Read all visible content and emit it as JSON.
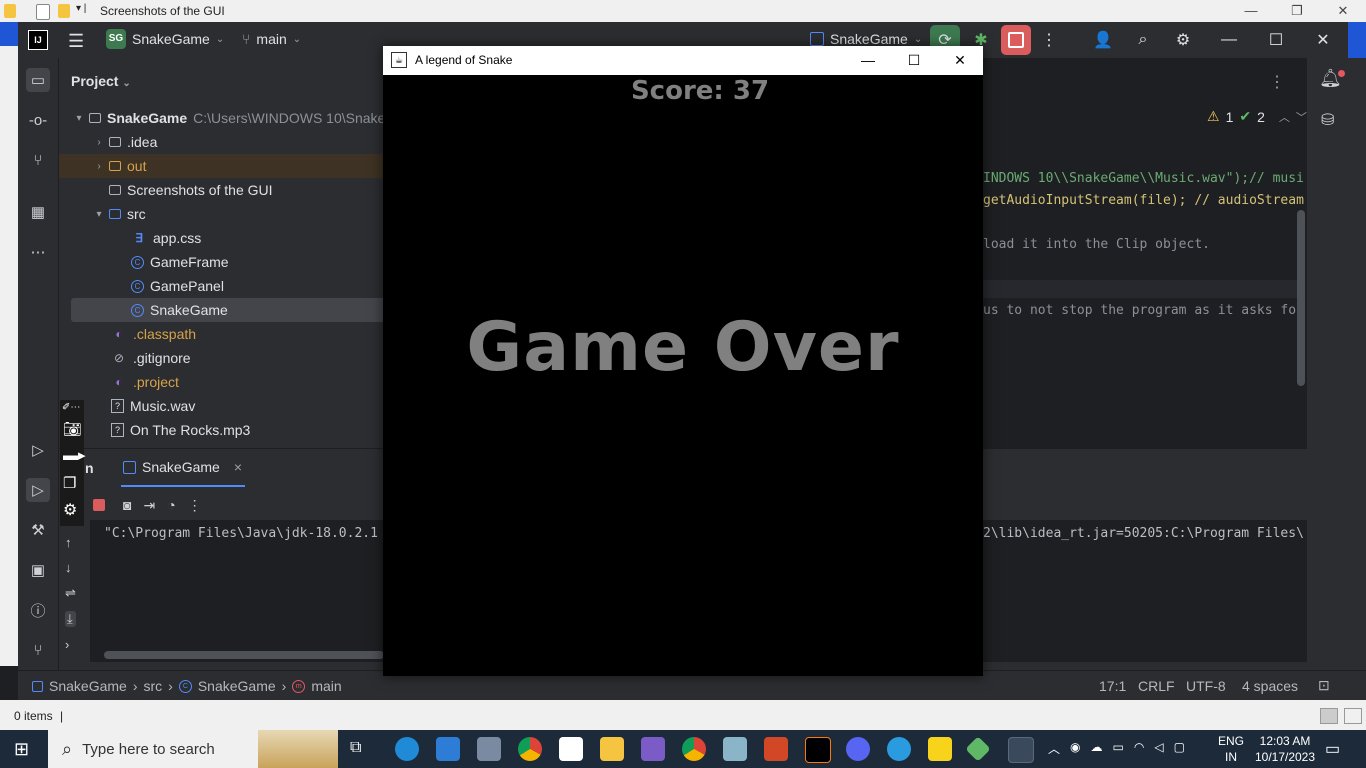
{
  "explorer": {
    "title": "Screenshots of the GUI",
    "status_items": "0 items"
  },
  "ide": {
    "project_badge": "SG",
    "project_name": "SnakeGame",
    "branch": "main",
    "run_config": "SnakeGame"
  },
  "project_panel": {
    "header": "Project",
    "root_name": "SnakeGame",
    "root_path": "C:\\Users\\WINDOWS 10\\SnakeG",
    "items": [
      {
        "label": ".idea"
      },
      {
        "label": "out"
      },
      {
        "label": "Screenshots of the GUI"
      },
      {
        "label": "src"
      },
      {
        "label": "app.css"
      },
      {
        "label": "GameFrame"
      },
      {
        "label": "GamePanel"
      },
      {
        "label": "SnakeGame"
      },
      {
        "label": ".classpath"
      },
      {
        "label": ".gitignore"
      },
      {
        "label": ".project"
      },
      {
        "label": "Music.wav"
      },
      {
        "label": "On The Rocks.mp3"
      }
    ]
  },
  "editor": {
    "warnings": "1",
    "checks": "2",
    "code_lines": [
      "INDOWS 10\\\\SnakeGame\\\\Music.wav\");// musi",
      "getAudioInputStream(file); // audioStream",
      "load it into the Clip object.",
      "us to not stop the program as it asks fo"
    ]
  },
  "run": {
    "tab_prefix": "n",
    "tab_label": "SnakeGame",
    "console_left": "\"C:\\Program Files\\Java\\jdk-18.0.2.1",
    "console_right": "2\\lib\\idea_rt.jar=50205:C:\\Program Files\\"
  },
  "status": {
    "crumbs": [
      "SnakeGame",
      "src",
      "SnakeGame",
      "main"
    ],
    "position": "17:1",
    "line_sep": "CRLF",
    "encoding": "UTF-8",
    "indent": "4 spaces"
  },
  "game": {
    "window_title": "A legend of Snake",
    "score": "Score: 37",
    "game_over": "Game Over"
  },
  "taskbar": {
    "search_placeholder": "Type here to search",
    "lang": "ENG",
    "region": "IN",
    "time": "12:03 AM",
    "date": "10/17/2023"
  },
  "colors": {
    "ide_bg": "#2b2d30",
    "editor_bg": "#1e1f22",
    "game_text": "#808080",
    "folder_out": "#d6a24b",
    "class_icon": "#548af7"
  }
}
